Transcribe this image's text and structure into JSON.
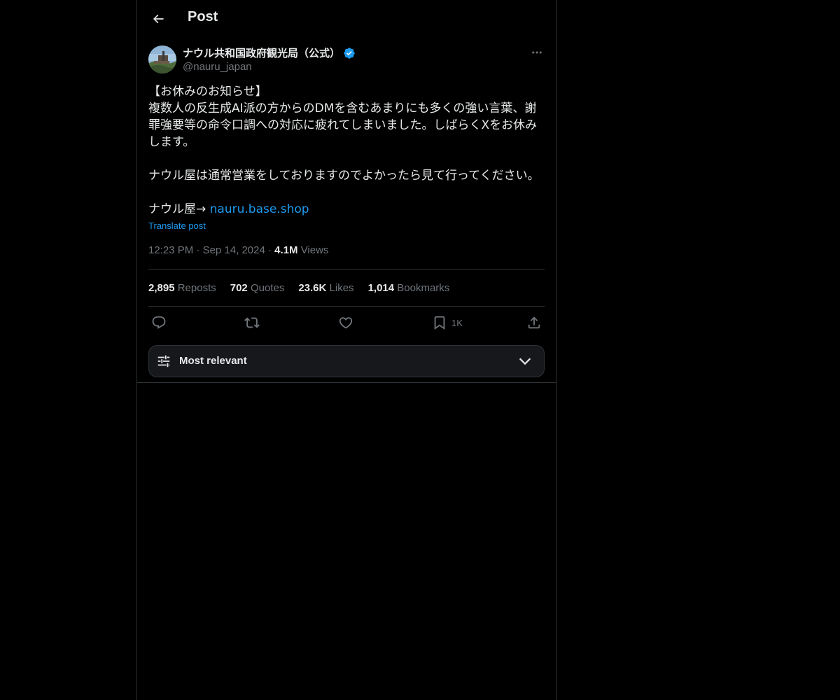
{
  "header": {
    "title": "Post",
    "back_icon": "arrow-left-icon"
  },
  "author": {
    "name": "ナウル共和国政府観光局（公式）",
    "handle": "@nauru_japan",
    "verified_color": "#1d9bf0"
  },
  "post": {
    "lines": [
      "【お休みのお知らせ】",
      "複数人の反生成AI派の方からのDMを含むあまりにも多くの強い言葉、謝罪強要等の命令口調への対応に疲れてしまいました。しばらくXをお休みします。",
      "ナウル屋は通常営業をしておりますのでよかったら見て行ってください。",
      "ナウル屋→ "
    ],
    "link_text": "nauru.base.shop",
    "translate_label": "Translate post"
  },
  "meta": {
    "time": "12:23 PM",
    "separator": "·",
    "date": "Sep 14, 2024",
    "views_count": "4.1M",
    "views_label": "Views"
  },
  "stats": {
    "reposts_count": "2,895",
    "reposts_label": "Reposts",
    "quotes_count": "702",
    "quotes_label": "Quotes",
    "likes_count": "23.6K",
    "likes_label": "Likes",
    "bookmarks_count": "1,014",
    "bookmarks_label": "Bookmarks"
  },
  "actions": {
    "bookmark_count": "1K"
  },
  "sort": {
    "label": "Most relevant"
  },
  "colors": {
    "background": "#000000",
    "text": "#e7e9ea",
    "muted": "#71767b",
    "accent": "#1d9bf0",
    "border": "#2f3336"
  }
}
